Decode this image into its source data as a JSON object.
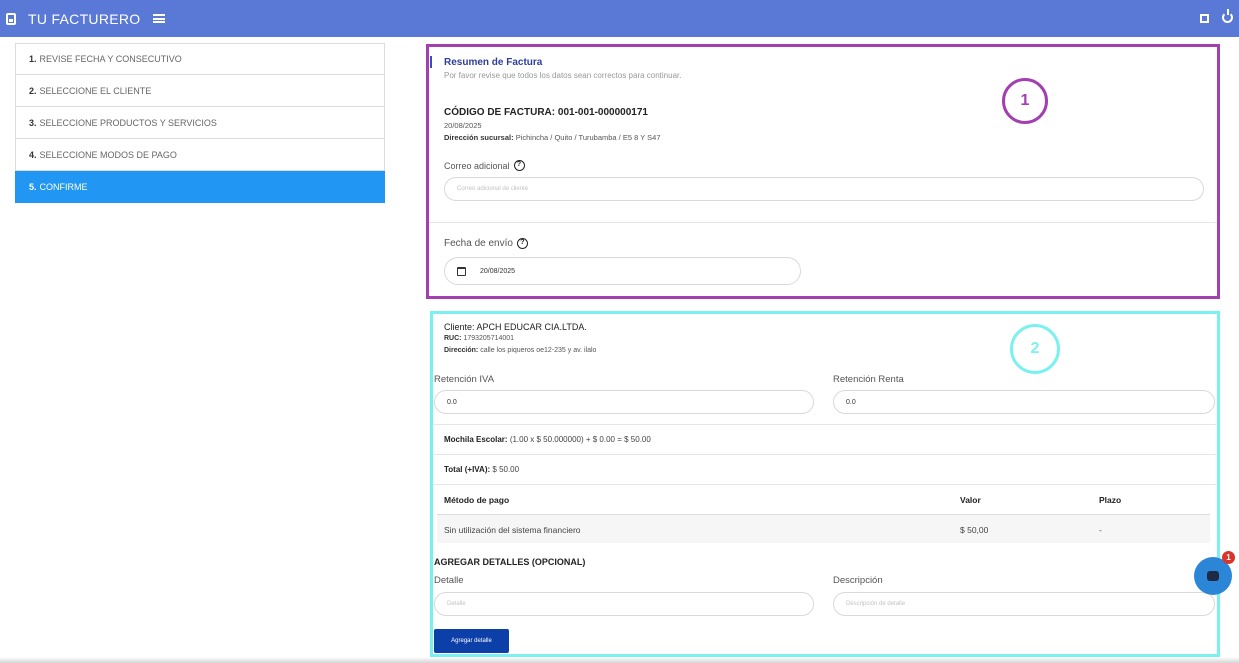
{
  "app": {
    "title": "TU FACTURERO"
  },
  "steps": [
    {
      "num": "1.",
      "label": "REVISE FECHA Y CONSECUTIVO"
    },
    {
      "num": "2.",
      "label": "SELECCIONE EL CLIENTE"
    },
    {
      "num": "3.",
      "label": "SELECCIONE PRODUCTOS Y SERVICIOS"
    },
    {
      "num": "4.",
      "label": "SELECCIONE MODOS DE PAGO"
    },
    {
      "num": "5.",
      "label": "CONFIRME"
    }
  ],
  "active_step": 5,
  "summary": {
    "title": "Resumen de Factura",
    "subtitle": "Por favor revise que todos los datos sean correctos para continuar.",
    "code_label": "CÓDIGO DE FACTURA: 001-001-000000171",
    "date": "20/08/2025",
    "branch_label": "Dirección sucursal:",
    "branch_value": "Pichincha / Quito / Turubamba / E5 8 Y S47",
    "email_label": "Correo adicional",
    "email_placeholder": "Correo adicional de cliente",
    "send_date_label": "Fecha de envío",
    "send_date_value": "20/08/2025"
  },
  "client": {
    "name": "Cliente: APCH EDUCAR CIA.LTDA.",
    "ruc_label": "RUC:",
    "ruc_value": "1793205714001",
    "address_label": "Dirección:",
    "address_value": "calle los piqueros oe12-235 y av. ilalo"
  },
  "retentions": {
    "iva_label": "Retención IVA",
    "iva_value": "0.0",
    "renta_label": "Retención Renta",
    "renta_value": "0.0"
  },
  "items": {
    "product_label": "Mochila Escolar:",
    "product_calc": "(1.00 x $ 50.000000) + $ 0.00 = $ 50.00",
    "total_label": "Total (+IVA):",
    "total_value": "$ 50.00"
  },
  "payments": {
    "headers": [
      "Método de pago",
      "Valor",
      "Plazo"
    ],
    "rows": [
      {
        "method": "Sin utilización del sistema financiero",
        "value": "$ 50,00",
        "term": "-"
      }
    ]
  },
  "details": {
    "title": "AGREGAR DETALLES (OPCIONAL)",
    "detail_label": "Detalle",
    "detail_placeholder": "Detalle",
    "desc_label": "Descripción",
    "desc_placeholder": "Descripción de detalle",
    "add_button": "Agregar detalle"
  },
  "annotations": {
    "badge_one": "1",
    "badge_two": "2"
  },
  "chat": {
    "badge_count": "1"
  },
  "colors": {
    "topbar": "#5a78d6",
    "active_step": "#2196f3",
    "box_one": "#a33fb0",
    "box_two": "#7af1ef",
    "button": "#0d3fa8"
  }
}
